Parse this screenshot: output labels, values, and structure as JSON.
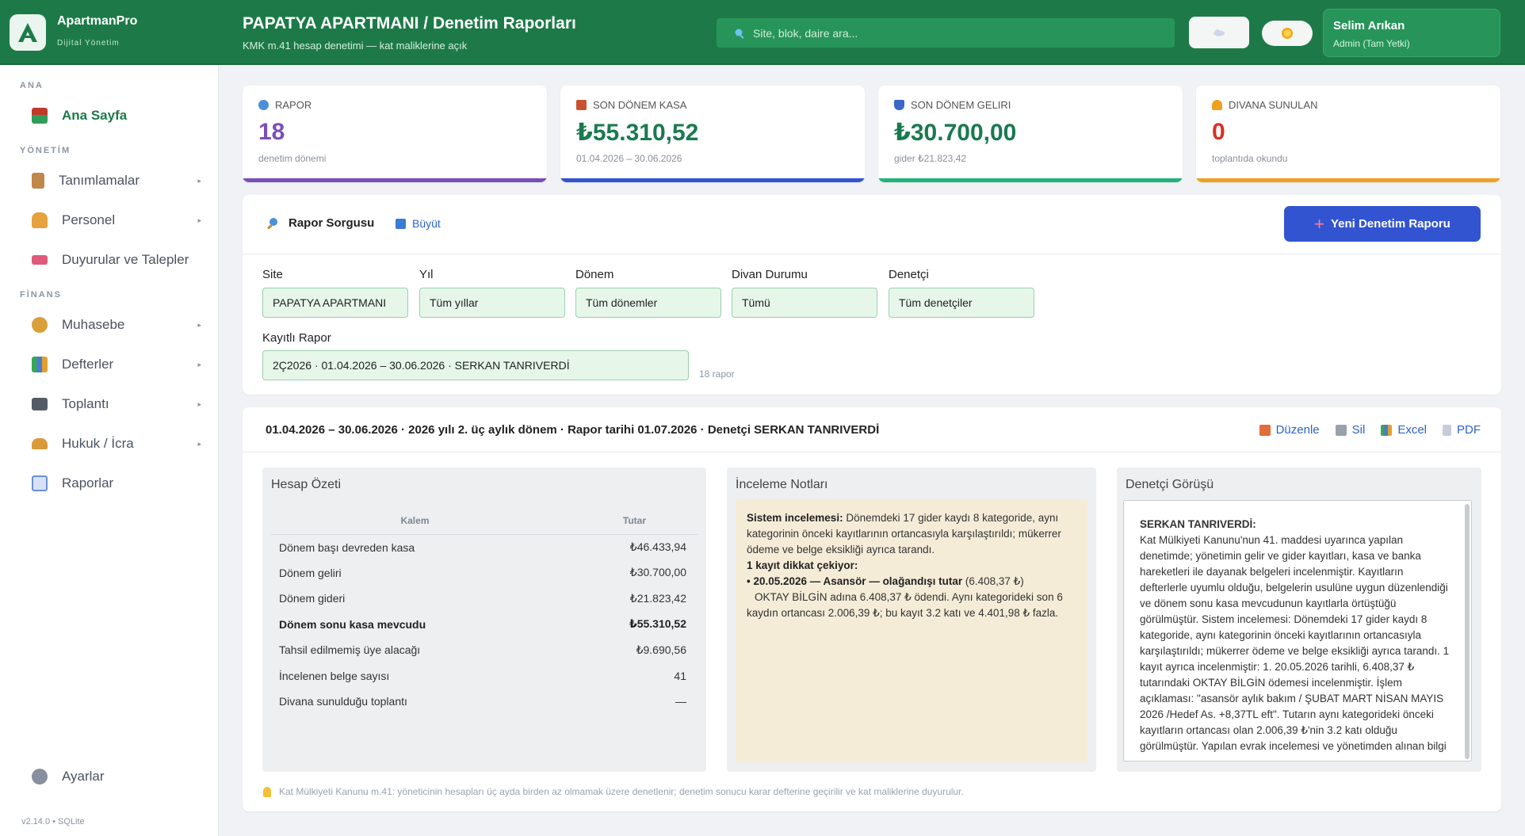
{
  "app": {
    "name": "ApartmanPro",
    "tagline": "Dijital Yönetim"
  },
  "header": {
    "title": "PAPATYA APARTMANI  /  Denetim Raporları",
    "subtitle": "KMK m.41 hesap denetimi — kat maliklerine açık",
    "search_placeholder": "Site, blok, daire ara...",
    "user_name": "Selim Arıkan",
    "user_role": "Admin (Tam Yetki)"
  },
  "sidebar": {
    "sections": [
      "ANA",
      "YÖNETİM",
      "FİNANS"
    ],
    "items": [
      {
        "label": "Ana Sayfa",
        "icon": "house-icon",
        "color": "#c0392b"
      },
      {
        "label": "Tanımlamalar",
        "icon": "clipboard-icon",
        "color": "#c0874b"
      },
      {
        "label": "Personel",
        "icon": "person-icon",
        "color": "#e6a23c"
      },
      {
        "label": "Duyurular ve Talepler",
        "icon": "megaphone-icon",
        "color": "#e05a7a"
      },
      {
        "label": "Muhasebe",
        "icon": "moneybag-icon",
        "color": "#d9a03a"
      },
      {
        "label": "Defterler",
        "icon": "bar-chart-icon",
        "color": "#4a7bd0"
      },
      {
        "label": "Toplantı",
        "icon": "clapper-icon",
        "color": "#555b66"
      },
      {
        "label": "Hukuk / İcra",
        "icon": "scales-icon",
        "color": "#d99a3a"
      },
      {
        "label": "Raporlar",
        "icon": "trend-chart-icon",
        "color": "#6b8fd6"
      },
      {
        "label": "Ayarlar",
        "icon": "gear-icon",
        "color": "#8a8fa0"
      }
    ],
    "version": "v2.14.0  •  SQLite"
  },
  "stats": [
    {
      "label": "RAPOR",
      "value": "18",
      "sub": "denetim dönemi",
      "color": "#7b4fb8",
      "icon": "magnifier-icon"
    },
    {
      "label": "SON DÖNEM KASA",
      "value": "₺55.310,52",
      "sub": "01.04.2026 – 30.06.2026",
      "color": "#1a7a4f",
      "bar": "#3354d1",
      "icon": "ledger-icon"
    },
    {
      "label": "SON DÖNEM GELIRI",
      "value": "₺30.700,00",
      "sub": "gider ₺21.823,42",
      "color": "#1a7a4f",
      "bar": "#21b37a",
      "icon": "arrow-up-icon"
    },
    {
      "label": "DIVANA SUNULAN",
      "value": "0",
      "sub": "toplantıda okundu",
      "color": "#d93025",
      "bar": "#f0a020",
      "icon": "bell-icon"
    }
  ],
  "query": {
    "title": "Rapor Sorgusu",
    "expand": "Büyüt",
    "new_button": "Yeni Denetim Raporu",
    "filters": {
      "site": {
        "label": "Site",
        "value": "PAPATYA APARTMANI"
      },
      "year": {
        "label": "Yıl",
        "value": "Tüm yıllar"
      },
      "period": {
        "label": "Dönem",
        "value": "Tüm dönemler"
      },
      "divan": {
        "label": "Divan Durumu",
        "value": "Tümü"
      },
      "auditor": {
        "label": "Denetçi",
        "value": "Tüm denetçiler"
      }
    },
    "saved": {
      "label": "Kayıtlı Rapor",
      "value": "2Ç2026  ·  01.04.2026 – 30.06.2026  ·  SERKAN TANRIVERDİ"
    },
    "count": "18 rapor"
  },
  "report": {
    "heading": "01.04.2026 – 30.06.2026  ·  2026 yılı 2. üç aylık dönem  ·  Rapor tarihi 01.07.2026  ·  Denetçi SERKAN TANRIVERDİ",
    "actions": {
      "edit": "Düzenle",
      "delete": "Sil",
      "excel": "Excel",
      "pdf": "PDF"
    },
    "summary": {
      "title": "Hesap Özeti",
      "col_item": "Kalem",
      "col_amount": "Tutar",
      "rows": [
        {
          "item": "Dönem başı devreden kasa",
          "amount": "₺46.433,94"
        },
        {
          "item": "Dönem geliri",
          "amount": "₺30.700,00"
        },
        {
          "item": "Dönem gideri",
          "amount": "₺21.823,42"
        },
        {
          "item": "Dönem sonu kasa mevcudu",
          "amount": "₺55.310,52"
        },
        {
          "item": "Tahsil edilmemiş üye alacağı",
          "amount": "₺9.690,56"
        },
        {
          "item": "İncelenen belge sayısı",
          "amount": "41"
        },
        {
          "item": "Divana sunulduğu toplantı",
          "amount": "—"
        }
      ]
    },
    "notes": {
      "title": "İnceleme Notları",
      "system_label": "Sistem incelemesi:",
      "system_text": " Dönemdeki 17 gider kaydı 8 kategoride, aynı kategorinin önceki kayıtlarının ortancasıyla karşılaştırıldı; mükerrer ödeme ve belge eksikliği ayrıca tarandı.",
      "flag_label": "1 kayıt dikkat çekiyor:",
      "bullet_label": "• 20.05.2026 — Asansör — olağandışı tutar",
      "bullet_amount": " (6.408,37 ₺)",
      "bullet_text": "OKTAY BİLGİN adına 6.408,37 ₺ ödendi. Aynı kategorideki son 6 kaydın ortancası 2.006,39 ₺; bu kayıt 3.2 katı ve 4.401,98 ₺ fazla."
    },
    "opinion": {
      "title": "Denetçi Görüşü",
      "auditor": "SERKAN TANRIVERDİ:",
      "text": "Kat Mülkiyeti Kanunu'nun 41. maddesi uyarınca yapılan denetimde; yönetimin gelir ve gider kayıtları, kasa ve banka hareketleri ile dayanak belgeleri incelenmiştir. Kayıtların defterlerle uyumlu olduğu, belgelerin usulüne uygun düzenlendiği ve dönem sonu kasa mevcudunun kayıtlarla örtüştüğü görülmüştür. Sistem incelemesi: Dönemdeki 17 gider kaydı 8 kategoride, aynı kategorinin önceki kayıtlarının ortancasıyla karşılaştırıldı; mükerrer ödeme ve belge eksikliği ayrıca tarandı. 1 kayıt ayrıca incelenmiştir: 1. 20.05.2026 tarihli, 6.408,37 ₺ tutarındaki OKTAY BİLGİN ödemesi incelenmiştir. İşlem açıklaması: \"asansör aylık bakım / ŞUBAT MART NİSAN MAYIS 2026 /Hedef As. +8,37TL eft\". Tutarın aynı kategorideki önceki kayıtların ortancası olan 2.006,39 ₺'nin 3.2 katı olduğu görülmüştür. Yapılan evrak incelemesi ve yönetimden alınan bilgi"
    },
    "footnote": "Kat Mülkiyeti Kanunu m.41: yöneticinin hesapları üç ayda birden az olmamak üzere denetlenir; denetim sonucu karar defterine geçirilir ve kat maliklerine duyurulur."
  },
  "colors": {
    "header": "#1d7a48",
    "accent": "#3354d1",
    "filter_bg": "#e6f7ea"
  }
}
